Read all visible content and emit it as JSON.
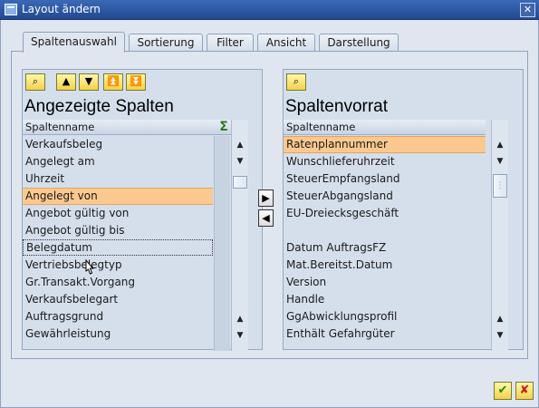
{
  "window": {
    "title": "Layout ändern",
    "close_glyph": "✕"
  },
  "tabs": [
    {
      "label": "Spaltenauswahl",
      "active": true
    },
    {
      "label": "Sortierung",
      "active": false
    },
    {
      "label": "Filter",
      "active": false
    },
    {
      "label": "Ansicht",
      "active": false
    },
    {
      "label": "Darstellung",
      "active": false
    }
  ],
  "left_panel": {
    "title": "Angezeigte Spalten",
    "column_header": "Spaltenname",
    "sigma_glyph": "Σ",
    "toolbar": {
      "find_glyph": "⌕",
      "up_glyph": "▲",
      "down_glyph": "▼",
      "top_glyph": "⏫",
      "bottom_glyph": "⏬"
    },
    "rows": [
      {
        "label": "Verkaufsbeleg",
        "state": "normal"
      },
      {
        "label": "Angelegt am",
        "state": "normal"
      },
      {
        "label": "Uhrzeit",
        "state": "normal"
      },
      {
        "label": "Angelegt von",
        "state": "selected"
      },
      {
        "label": "Angebot gültig von",
        "state": "normal"
      },
      {
        "label": "Angebot gültig bis",
        "state": "normal"
      },
      {
        "label": "Belegdatum",
        "state": "focused"
      },
      {
        "label": "Vertriebsbelegtyp",
        "state": "normal"
      },
      {
        "label": "Gr.Transakt.Vorgang",
        "state": "normal"
      },
      {
        "label": "Verkaufsbelegart",
        "state": "normal"
      },
      {
        "label": "Auftragsgrund",
        "state": "normal"
      },
      {
        "label": "Gewährleistung",
        "state": "normal"
      }
    ]
  },
  "right_panel": {
    "title": "Spaltenvorrat",
    "column_header": "Spaltenname",
    "toolbar": {
      "find_glyph": "⌕"
    },
    "rows": [
      {
        "label": "Ratenplannummer",
        "state": "selected"
      },
      {
        "label": "Wunschlieferuhrzeit",
        "state": "normal"
      },
      {
        "label": "SteuerEmpfangsland",
        "state": "normal"
      },
      {
        "label": "SteuerAbgangsland",
        "state": "normal"
      },
      {
        "label": "EU-Dreiecksgeschäft",
        "state": "normal"
      },
      {
        "label": "",
        "state": "normal"
      },
      {
        "label": "Datum AuftragsFZ",
        "state": "normal"
      },
      {
        "label": "Mat.Bereitst.Datum",
        "state": "normal"
      },
      {
        "label": "Version",
        "state": "normal"
      },
      {
        "label": "Handle",
        "state": "normal"
      },
      {
        "label": "GgAbwicklungsprofil",
        "state": "normal"
      },
      {
        "label": "Enthält Gefahrgüter",
        "state": "normal"
      }
    ]
  },
  "move_buttons": {
    "add_glyph": "▶",
    "remove_glyph": "◀"
  },
  "scroll": {
    "up_glyph": "▲",
    "down_glyph": "▼",
    "grip_glyph": "⋮"
  },
  "footer": {
    "ok_glyph": "✔",
    "cancel_glyph": "✘"
  }
}
